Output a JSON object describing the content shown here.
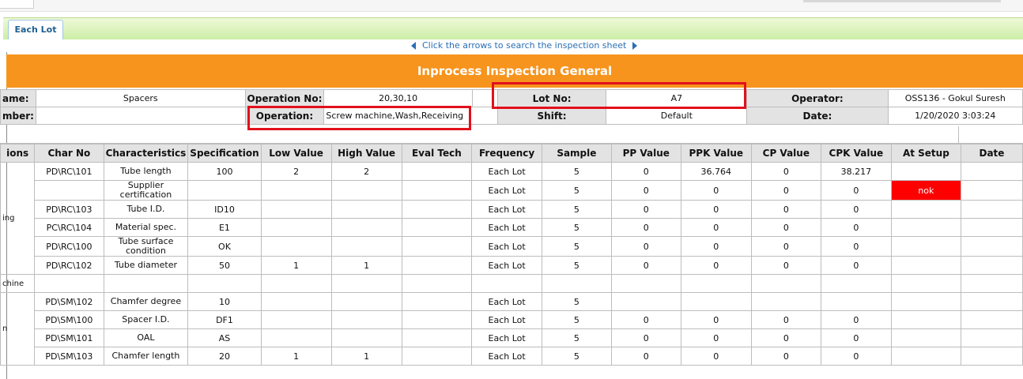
{
  "tabs": [
    {
      "label": "Each Lot"
    }
  ],
  "nav": {
    "hint": "Click the arrows to search the inspection sheet"
  },
  "title": "Inprocess Inspection General",
  "header": {
    "name_label": "ame:",
    "name_value": "Spacers",
    "operation_no_label": "Operation No:",
    "operation_no_value": "20,30,10",
    "lot_no_label": "Lot No:",
    "lot_no_value": "A7",
    "operator_label": "Operator:",
    "operator_value": "OSS136 - Gokul Suresh",
    "number_label": "mber:",
    "number_value": "",
    "operation_label": "Operation:",
    "operation_value": "Screw machine,Wash,Receiving",
    "shift_label": "Shift:",
    "shift_value": "Default",
    "date_label": "Date:",
    "date_value": "1/20/2020 3:03:24"
  },
  "columns": [
    "ions",
    "Char No",
    "Characteristics",
    "Specification",
    "Low Value",
    "High Value",
    "Eval Tech",
    "Frequency",
    "Sample",
    "PP Value",
    "PPK Value",
    "CP Value",
    "CPK Value",
    "At Setup",
    "Date"
  ],
  "groups": {
    "receiving": "ing",
    "screw_header": "chine",
    "screw_rows": "n"
  },
  "rows_a": [
    {
      "char_no": "PD\\RC\\101",
      "char": "Tube length",
      "spec": "100",
      "low": "2",
      "high": "2",
      "eval": "",
      "freq": "Each Lot",
      "sample": "5",
      "pp": "0",
      "ppk": "36.764",
      "cp": "0",
      "cpk": "38.217",
      "setup": "",
      "date": ""
    },
    {
      "char_no": "",
      "char": "Supplier certification",
      "spec": "",
      "low": "",
      "high": "",
      "eval": "",
      "freq": "Each Lot",
      "sample": "5",
      "pp": "0",
      "ppk": "0",
      "cp": "0",
      "cpk": "0",
      "setup": "nok",
      "date": ""
    },
    {
      "char_no": "PD\\RC\\103",
      "char": "Tube I.D.",
      "spec": "ID10",
      "low": "",
      "high": "",
      "eval": "",
      "freq": "Each Lot",
      "sample": "5",
      "pp": "0",
      "ppk": "0",
      "cp": "0",
      "cpk": "0",
      "setup": "",
      "date": ""
    },
    {
      "char_no": "PC\\RC\\104",
      "char": "Material spec.",
      "spec": "E1",
      "low": "",
      "high": "",
      "eval": "",
      "freq": "Each Lot",
      "sample": "5",
      "pp": "0",
      "ppk": "0",
      "cp": "0",
      "cpk": "0",
      "setup": "",
      "date": ""
    },
    {
      "char_no": "PD\\RC\\100",
      "char": "Tube surface condition",
      "spec": "OK",
      "low": "",
      "high": "",
      "eval": "",
      "freq": "Each Lot",
      "sample": "5",
      "pp": "0",
      "ppk": "0",
      "cp": "0",
      "cpk": "0",
      "setup": "",
      "date": ""
    },
    {
      "char_no": "PD\\RC\\102",
      "char": "Tube diameter",
      "spec": "50",
      "low": "1",
      "high": "1",
      "eval": "",
      "freq": "Each Lot",
      "sample": "5",
      "pp": "0",
      "ppk": "0",
      "cp": "0",
      "cpk": "0",
      "setup": "",
      "date": ""
    }
  ],
  "rows_b": [
    {
      "char_no": "PD\\SM\\102",
      "char": "Chamfer degree",
      "spec": "10",
      "low": "",
      "high": "",
      "eval": "",
      "freq": "Each Lot",
      "sample": "5",
      "pp": "",
      "ppk": "",
      "cp": "",
      "cpk": "",
      "setup": "",
      "date": ""
    },
    {
      "char_no": "PD\\SM\\100",
      "char": "Spacer I.D.",
      "spec": "DF1",
      "low": "",
      "high": "",
      "eval": "",
      "freq": "Each Lot",
      "sample": "5",
      "pp": "0",
      "ppk": "0",
      "cp": "0",
      "cpk": "0",
      "setup": "",
      "date": ""
    },
    {
      "char_no": "PD\\SM\\101",
      "char": "OAL",
      "spec": "AS",
      "low": "",
      "high": "",
      "eval": "",
      "freq": "Each Lot",
      "sample": "5",
      "pp": "0",
      "ppk": "0",
      "cp": "0",
      "cpk": "0",
      "setup": "",
      "date": ""
    },
    {
      "char_no": "PD\\SM\\103",
      "char": "Chamfer length",
      "spec": "20",
      "low": "1",
      "high": "1",
      "eval": "",
      "freq": "Each Lot",
      "sample": "5",
      "pp": "0",
      "ppk": "0",
      "cp": "0",
      "cpk": "0",
      "setup": "",
      "date": ""
    }
  ],
  "colors": {
    "title_bg": "#f7941d",
    "tab_bar": "#cdeea6",
    "nok": "#ff0000",
    "highlight": "#e2101b",
    "header_bg": "#e3e3e3"
  }
}
